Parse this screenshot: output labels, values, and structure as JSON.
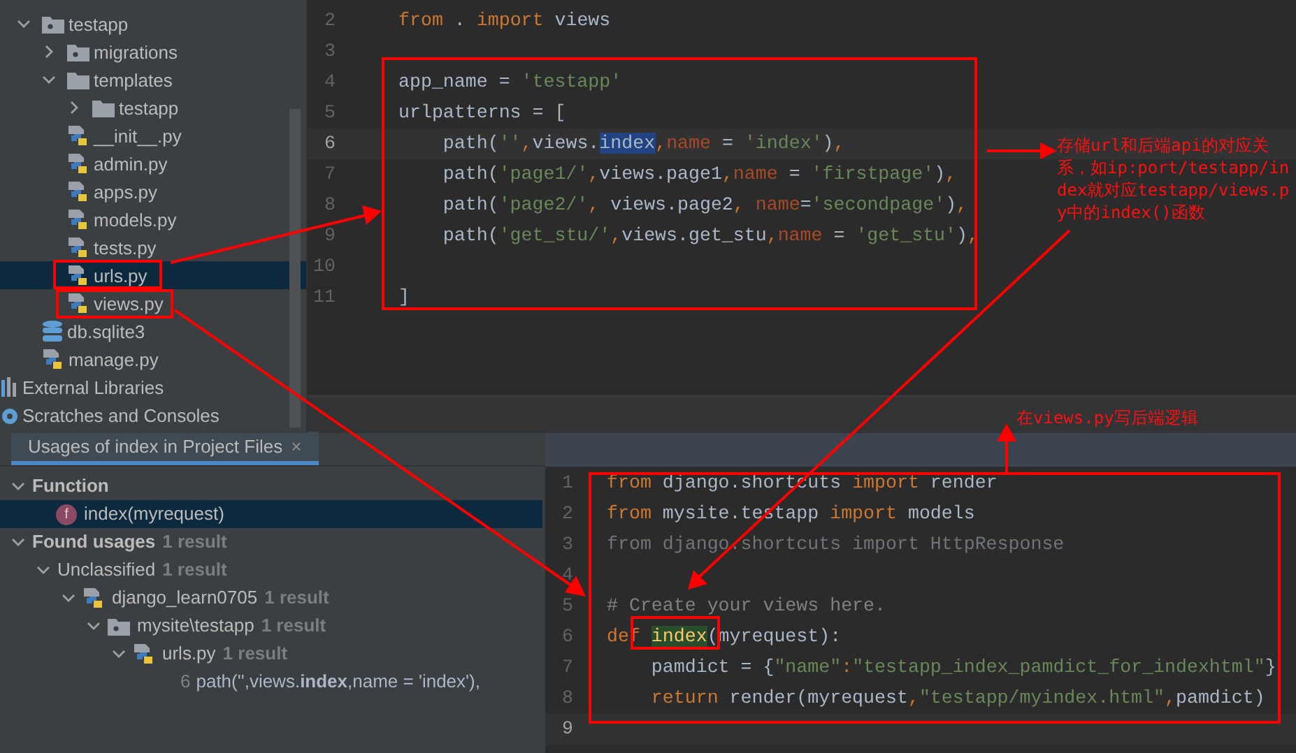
{
  "project_tree": {
    "items": [
      {
        "label": "testapp",
        "kind": "package",
        "expanded": true,
        "selected": false,
        "children": [
          {
            "label": "migrations",
            "kind": "package",
            "expanded": false,
            "selected": false
          },
          {
            "label": "templates",
            "kind": "folder",
            "expanded": true,
            "selected": false,
            "children": [
              {
                "label": "testapp",
                "kind": "folder",
                "expanded": false,
                "selected": false
              }
            ]
          },
          {
            "label": "__init__.py",
            "kind": "python",
            "selected": false
          },
          {
            "label": "admin.py",
            "kind": "python",
            "selected": false
          },
          {
            "label": "apps.py",
            "kind": "python",
            "selected": false
          },
          {
            "label": "models.py",
            "kind": "python",
            "selected": false
          },
          {
            "label": "tests.py",
            "kind": "python",
            "selected": false
          },
          {
            "label": "urls.py",
            "kind": "python",
            "selected": true
          },
          {
            "label": "views.py",
            "kind": "python",
            "selected": false
          }
        ]
      },
      {
        "label": "db.sqlite3",
        "kind": "database",
        "selected": false
      },
      {
        "label": "manage.py",
        "kind": "python",
        "selected": false
      }
    ],
    "root_items": [
      {
        "label": "External Libraries",
        "kind": "libraries",
        "selected": false
      },
      {
        "label": "Scratches and Consoles",
        "kind": "scratches",
        "selected": false
      }
    ]
  },
  "urls_editor": {
    "lines": [
      {
        "number": "2",
        "current": false,
        "tokens": [
          {
            "kind": "kw",
            "text": "from"
          },
          {
            "kind": "plain",
            "text": " . "
          },
          {
            "kind": "kw",
            "text": "import"
          },
          {
            "kind": "plain",
            "text": " views"
          }
        ]
      },
      {
        "number": "3",
        "current": false
      },
      {
        "number": "4",
        "current": false,
        "tokens": [
          {
            "kind": "plain",
            "text": "app_name = "
          },
          {
            "kind": "str",
            "text": "'testapp'"
          }
        ]
      },
      {
        "number": "5",
        "current": false,
        "tokens": [
          {
            "kind": "plain",
            "text": "urlpatterns = ["
          }
        ]
      },
      {
        "number": "6",
        "current": true,
        "tokens": [
          {
            "kind": "plain",
            "text": "    path("
          },
          {
            "kind": "str",
            "text": "''"
          },
          {
            "kind": "kw",
            "text": ","
          },
          {
            "kind": "plain",
            "text": "views."
          },
          {
            "kind": "sel",
            "text": "index"
          },
          {
            "kind": "kw",
            "text": ","
          },
          {
            "kind": "param",
            "text": "name"
          },
          {
            "kind": "plain",
            "text": " = "
          },
          {
            "kind": "str",
            "text": "'index'"
          },
          {
            "kind": "plain",
            "text": ")"
          },
          {
            "kind": "kw",
            "text": ","
          }
        ]
      },
      {
        "number": "7",
        "current": false,
        "tokens": [
          {
            "kind": "plain",
            "text": "    path("
          },
          {
            "kind": "str",
            "text": "'page1/'"
          },
          {
            "kind": "kw",
            "text": ","
          },
          {
            "kind": "plain",
            "text": "views.page1"
          },
          {
            "kind": "kw",
            "text": ","
          },
          {
            "kind": "param",
            "text": "name"
          },
          {
            "kind": "plain",
            "text": " = "
          },
          {
            "kind": "str",
            "text": "'firstpage'"
          },
          {
            "kind": "plain",
            "text": ")"
          },
          {
            "kind": "kw",
            "text": ","
          }
        ]
      },
      {
        "number": "8",
        "current": false,
        "tokens": [
          {
            "kind": "plain",
            "text": "    path("
          },
          {
            "kind": "str",
            "text": "'page2/'"
          },
          {
            "kind": "kw",
            "text": ","
          },
          {
            "kind": "plain",
            "text": " views.page2"
          },
          {
            "kind": "kw",
            "text": ", "
          },
          {
            "kind": "param",
            "text": "name"
          },
          {
            "kind": "plain",
            "text": "="
          },
          {
            "kind": "str",
            "text": "'secondpage'"
          },
          {
            "kind": "plain",
            "text": ")"
          },
          {
            "kind": "kw",
            "text": ","
          }
        ]
      },
      {
        "number": "9",
        "current": false,
        "tokens": [
          {
            "kind": "plain",
            "text": "    path("
          },
          {
            "kind": "str",
            "text": "'get_stu/'"
          },
          {
            "kind": "kw",
            "text": ","
          },
          {
            "kind": "plain",
            "text": "views.get_stu"
          },
          {
            "kind": "kw",
            "text": ","
          },
          {
            "kind": "param",
            "text": "name"
          },
          {
            "kind": "plain",
            "text": " = "
          },
          {
            "kind": "str",
            "text": "'get_stu'"
          },
          {
            "kind": "plain",
            "text": ")"
          },
          {
            "kind": "kw",
            "text": ","
          }
        ]
      },
      {
        "number": "10",
        "current": false
      },
      {
        "number": "11",
        "current": false,
        "tokens": [
          {
            "kind": "plain",
            "text": "]"
          }
        ]
      }
    ]
  },
  "usages_panel": {
    "tab": {
      "label": "Usages of index in Project Files",
      "close": "×",
      "selected": true
    },
    "nodes": [
      {
        "kind": "group",
        "label": "Function",
        "expanded": true,
        "selected": false,
        "children": [
          {
            "kind": "function",
            "badge": "f",
            "label": "index(myrequest)",
            "selected": true
          }
        ]
      },
      {
        "kind": "group",
        "label": "Found usages",
        "count": "1 result",
        "expanded": true,
        "selected": false,
        "children": [
          {
            "kind": "category",
            "label": "Unclassified",
            "count": "1 result",
            "expanded": true,
            "selected": false,
            "children": [
              {
                "kind": "project",
                "label": "django_learn0705",
                "count": "1 result",
                "expanded": true,
                "selected": false,
                "children": [
                  {
                    "kind": "package",
                    "label": "mysite\\testapp",
                    "count": "1 result",
                    "expanded": true,
                    "selected": false,
                    "children": [
                      {
                        "kind": "file",
                        "label": "urls.py",
                        "count": "1 result",
                        "expanded": true,
                        "selected": false,
                        "children": [
                          {
                            "kind": "usage",
                            "line": "6",
                            "text": "path('',views.**index**,name = 'index'),",
                            "selected": false
                          }
                        ]
                      }
                    ]
                  }
                ]
              }
            ]
          }
        ]
      }
    ]
  },
  "views_editor": {
    "lines": [
      {
        "number": "1",
        "current": false,
        "tokens": [
          {
            "kind": "kw",
            "text": "from"
          },
          {
            "kind": "plain",
            "text": " django.shortcuts "
          },
          {
            "kind": "kw",
            "text": "import"
          },
          {
            "kind": "plain",
            "text": " render"
          }
        ]
      },
      {
        "number": "2",
        "current": false,
        "tokens": [
          {
            "kind": "kw",
            "text": "from"
          },
          {
            "kind": "plain",
            "text": " mysite.testapp "
          },
          {
            "kind": "kw",
            "text": "import"
          },
          {
            "kind": "plain",
            "text": " models"
          }
        ]
      },
      {
        "number": "3",
        "current": false,
        "tokens": [
          {
            "kind": "dim",
            "text": "from django.shortcuts import HttpResponse"
          }
        ]
      },
      {
        "number": "4",
        "current": false
      },
      {
        "number": "5",
        "current": false,
        "tokens": [
          {
            "kind": "comment",
            "text": "# Create your views here."
          }
        ]
      },
      {
        "number": "6",
        "current": false,
        "tokens": [
          {
            "kind": "kw",
            "text": "def "
          },
          {
            "kind": "fn",
            "text": "index"
          },
          {
            "kind": "plain",
            "text": "(myrequest):"
          }
        ]
      },
      {
        "number": "7",
        "current": false,
        "tokens": [
          {
            "kind": "plain",
            "text": "    pamdict = {"
          },
          {
            "kind": "str",
            "text": "\"name\""
          },
          {
            "kind": "kw",
            "text": ":"
          },
          {
            "kind": "str",
            "text": "\"testapp_index_pamdict_for_indexhtml\""
          },
          {
            "kind": "plain",
            "text": "}"
          }
        ]
      },
      {
        "number": "8",
        "current": false,
        "tokens": [
          {
            "kind": "kw",
            "text": "    return"
          },
          {
            "kind": "plain",
            "text": " render(myrequest"
          },
          {
            "kind": "kw",
            "text": ","
          },
          {
            "kind": "str",
            "text": "\"testapp/myindex.html\""
          },
          {
            "kind": "kw",
            "text": ","
          },
          {
            "kind": "plain",
            "text": "pamdict)"
          }
        ]
      },
      {
        "number": "9",
        "current": true
      }
    ]
  },
  "annotations": {
    "notes": [
      {
        "kind": "mapping",
        "text": "存储url和后端api的对应关系，如ip:port/testapp/index就对应testapp/views.py中的index()函数"
      },
      {
        "kind": "views",
        "text": "在views.py写后端逻辑"
      }
    ]
  }
}
